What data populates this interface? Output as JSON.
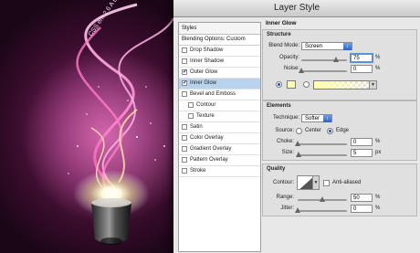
{
  "window": {
    "title": "Layer Style"
  },
  "style_list": {
    "header": "Styles",
    "blending": "Blending Options: Custom",
    "items": [
      {
        "label": "Drop Shadow",
        "checked": false,
        "indent": false,
        "selected": false
      },
      {
        "label": "Inner Shadow",
        "checked": false,
        "indent": false,
        "selected": false
      },
      {
        "label": "Outer Glow",
        "checked": true,
        "indent": false,
        "selected": false
      },
      {
        "label": "Inner Glow",
        "checked": true,
        "indent": false,
        "selected": true
      },
      {
        "label": "Bevel and Emboss",
        "checked": false,
        "indent": false,
        "selected": false
      },
      {
        "label": "Contour",
        "checked": false,
        "indent": true,
        "selected": false
      },
      {
        "label": "Texture",
        "checked": false,
        "indent": true,
        "selected": false
      },
      {
        "label": "Satin",
        "checked": false,
        "indent": false,
        "selected": false
      },
      {
        "label": "Color Overlay",
        "checked": false,
        "indent": false,
        "selected": false
      },
      {
        "label": "Gradient Overlay",
        "checked": false,
        "indent": false,
        "selected": false
      },
      {
        "label": "Pattern Overlay",
        "checked": false,
        "indent": false,
        "selected": false
      },
      {
        "label": "Stroke",
        "checked": false,
        "indent": false,
        "selected": false
      }
    ]
  },
  "inner_glow": {
    "title": "Inner Glow",
    "structure": {
      "title": "Structure",
      "blend_mode_label": "Blend Mode:",
      "blend_mode": "Screen",
      "opacity_label": "Opacity:",
      "opacity": "75",
      "opacity_pct": 0.75,
      "noise_label": "Noise:",
      "noise": "0",
      "noise_pct": 0,
      "unit": "%",
      "glow_color": "#ffffb0"
    },
    "elements": {
      "title": "Elements",
      "technique_label": "Technique:",
      "technique": "Softer",
      "source_label": "Source:",
      "source_center": "Center",
      "source_edge": "Edge",
      "choke_label": "Choke:",
      "choke": "0",
      "choke_pct": 0,
      "size_label": "Size:",
      "size": "5",
      "size_pct": 0.02,
      "pct_unit": "%",
      "px_unit": "px"
    },
    "quality": {
      "title": "Quality",
      "contour_label": "Contour:",
      "anti_aliased_label": "Anti-aliased",
      "range_label": "Range:",
      "range": "50",
      "range_pct": 0.5,
      "jitter_label": "Jitter:",
      "jitter": "0",
      "jitter_pct": 0,
      "unit": "%"
    }
  },
  "artwork": {
    "spiral_text": "CSS em 2 6 A E ASS"
  },
  "colors": {
    "selection": "#b9d3ef",
    "glow": "#ffffb0",
    "background": "#6c1f55"
  }
}
